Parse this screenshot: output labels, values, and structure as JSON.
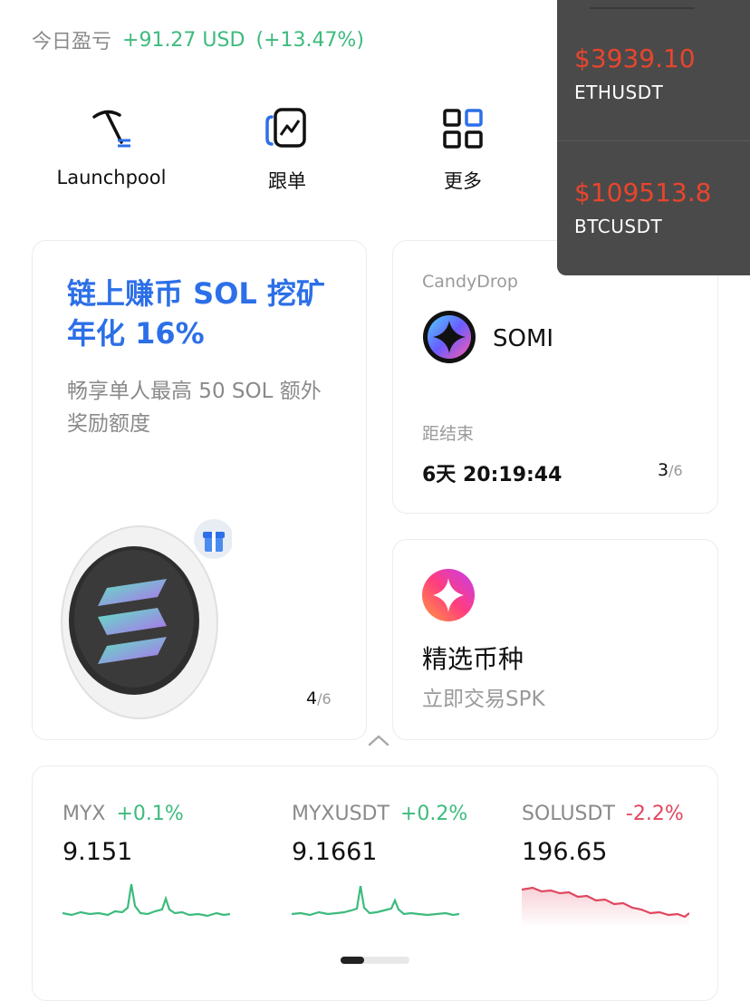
{
  "pnl": {
    "label": "今日盈亏",
    "value": "+91.27 USD",
    "percent": "(+13.47%)"
  },
  "quick_actions": [
    {
      "label": "Launchpool",
      "icon": "pickaxe-icon"
    },
    {
      "label": "跟单",
      "icon": "copy-trade-icon"
    },
    {
      "label": "更多",
      "icon": "grid-icon"
    }
  ],
  "promo": {
    "title": "链上赚币 SOL 挖矿年化 16%",
    "subtitle": "畅享单人最高 50 SOL 额外奖励额度",
    "page_current": "4",
    "page_total": "/6"
  },
  "candydrop": {
    "label": "CandyDrop",
    "coin": "SOMI",
    "end_label": "距结束",
    "countdown": "6天 20:19:44",
    "page_current": "3",
    "page_total": "/6"
  },
  "selected": {
    "title": "精选币种",
    "subtitle": "立即交易SPK"
  },
  "tickers": [
    {
      "symbol": "MYX",
      "change": "+0.1%",
      "price": "9.151",
      "trend": "up",
      "color": "#3dbb7d"
    },
    {
      "symbol": "MYXUSDT",
      "change": "+0.2%",
      "price": "9.1661",
      "trend": "up",
      "color": "#3dbb7d"
    },
    {
      "symbol": "SOLUSDT",
      "change": "-2.2%",
      "price": "196.65",
      "trend": "down",
      "color": "#e0475f"
    }
  ],
  "floating_prices": [
    {
      "price": "$3939.10",
      "symbol": "ETHUSDT"
    },
    {
      "price": "$109513.8",
      "symbol": "BTCUSDT"
    }
  ],
  "colors": {
    "accent_blue": "#2c6fe8",
    "up_green": "#3dbb7d",
    "down_red": "#e0475f",
    "overlay_price": "#e8452d"
  }
}
